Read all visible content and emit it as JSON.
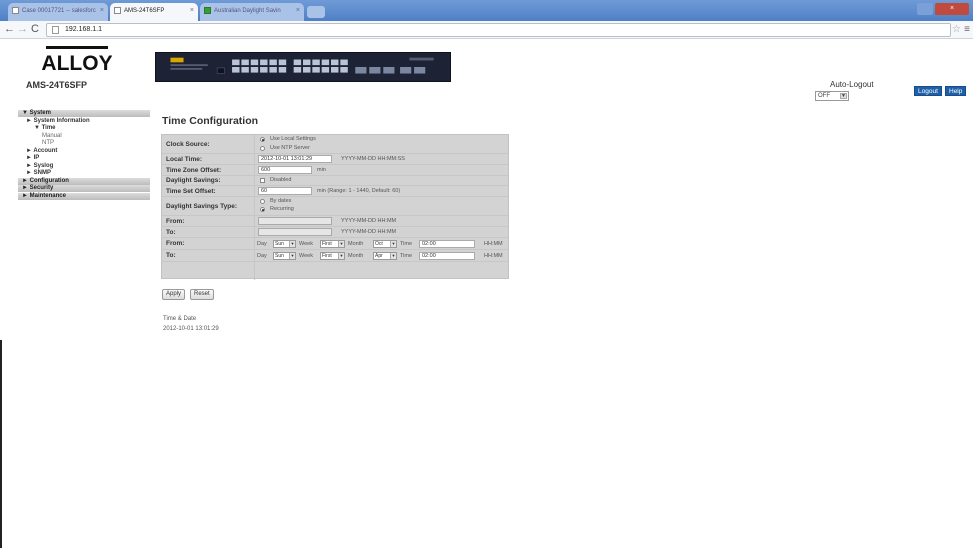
{
  "browser": {
    "tabs": [
      {
        "label": "Case 00017721 -- salesforc",
        "active": false
      },
      {
        "label": "AMS-24T6SFP",
        "active": true
      },
      {
        "label": "Australian Daylight Savin",
        "active": false
      }
    ],
    "url": "192.168.1.1"
  },
  "header": {
    "brand": "ALLOY",
    "model": "AMS-24T6SFP",
    "auto_logout_label": "Auto-Logout",
    "auto_logout_value": "OFF",
    "logout_label": "Logout",
    "help_label": "Help"
  },
  "sidebar": {
    "system": "▼ System",
    "system_information": "► System Information",
    "time": "▼ Time",
    "manual": "Manual",
    "ntp": "NTP",
    "account": "► Account",
    "ip": "► IP",
    "syslog": "► Syslog",
    "snmp": "► SNMP",
    "configuration": "► Configuration",
    "security": "► Security",
    "maintenance": "► Maintenance"
  },
  "page": {
    "title": "Time Configuration",
    "clock_source_label": "Clock Source:",
    "use_local_settings": "Use Local Settings",
    "use_ntp_server": "Use NTP Server",
    "local_time_label": "Local Time:",
    "local_time_value": "2012-10-01 13:01:29",
    "local_time_hint": "YYYY-MM-DD HH:MM:SS",
    "tz_offset_label": "Time Zone Offset:",
    "tz_offset_value": "600",
    "tz_offset_unit": "min",
    "daylight_savings_label": "Daylight Savings:",
    "daylight_savings_option": "Disabled",
    "time_set_offset_label": "Time Set Offset:",
    "time_set_offset_value": "60",
    "time_set_offset_hint": "min (Range: 1 - 1440, Default: 60)",
    "ds_type_label": "Daylight Savings Type:",
    "by_dates": "By dates",
    "recurring": "Recurring",
    "from_label": "From:",
    "to_label": "To:",
    "date_hint": "YYYY-MM-DD HH:MM",
    "rec_from": {
      "day_label": "Day",
      "day": "Sun",
      "week_label": "Week",
      "week": "First",
      "month_label": "Month",
      "month": "Oct",
      "time_label": "Time",
      "time": "02:00",
      "hint": "HH:MM"
    },
    "rec_to": {
      "day_label": "Day",
      "day": "Sun",
      "week_label": "Week",
      "week": "First",
      "month_label": "Month",
      "month": "Apr",
      "time_label": "Time",
      "time": "02:00",
      "hint": "HH:MM"
    },
    "apply_label": "Apply",
    "reset_label": "Reset",
    "time_date_label": "Time & Date",
    "time_date_value": "2012-10-01 13:01:29"
  }
}
